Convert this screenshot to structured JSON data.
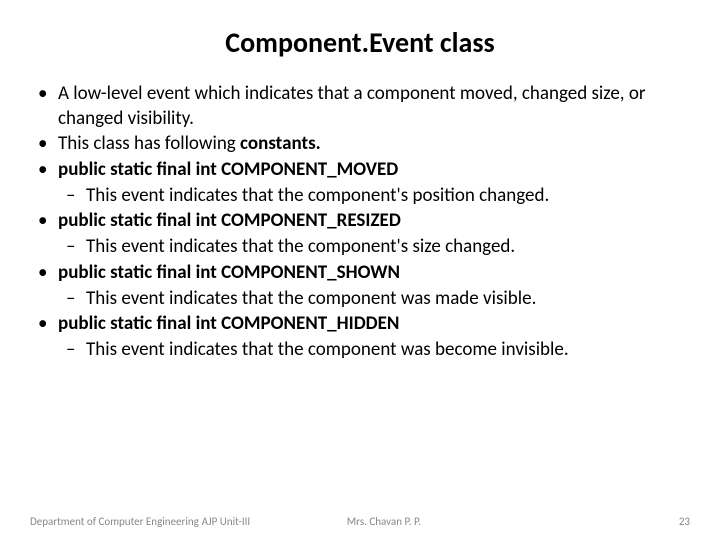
{
  "title": "Component.Event class",
  "bullets": {
    "b1": "A low-level event which indicates that a component moved, changed size, or changed visibility.",
    "b2_pre": "This class has  following ",
    "b2_bold": "constants.",
    "b3": "public static final int COMPONENT_MOVED",
    "b3_sub": "This event indicates that the component's position changed.",
    "b4": "public static final int COMPONENT_RESIZED",
    "b4_sub": "This event indicates that the component's size changed.",
    "b5": "public static final int COMPONENT_SHOWN",
    "b5_sub": "This event indicates that the component was made visible.",
    "b6": "public static final int COMPONENT_HIDDEN",
    "b6_sub": "This event indicates that the component was become invisible."
  },
  "footer": {
    "dept": "Department of Computer Engineering",
    "unit": "AJP Unit-III",
    "author": "Mrs. Chavan P. P.",
    "page": "23"
  }
}
